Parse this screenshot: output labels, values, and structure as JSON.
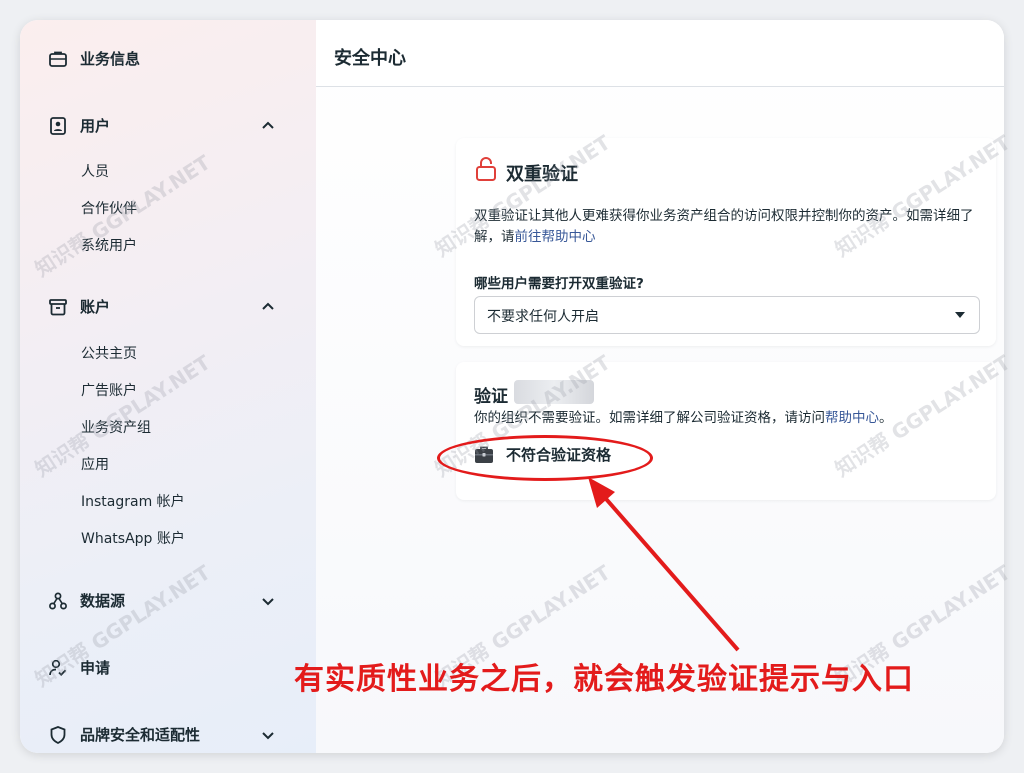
{
  "sidebar": {
    "sections": [
      {
        "label": "业务信息",
        "icon": "briefcase-icon",
        "expanded": null
      },
      {
        "label": "用户",
        "icon": "user-badge-icon",
        "expanded": true,
        "items": [
          "人员",
          "合作伙伴",
          "系统用户"
        ]
      },
      {
        "label": "账户",
        "icon": "archive-icon",
        "expanded": true,
        "items": [
          "公共主页",
          "广告账户",
          "业务资产组",
          "应用",
          "Instagram 帐户",
          "WhatsApp 账户"
        ]
      },
      {
        "label": "数据源",
        "icon": "data-source-icon",
        "expanded": false
      },
      {
        "label": "申请",
        "icon": "user-check-icon",
        "expanded": null
      },
      {
        "label": "品牌安全和适配性",
        "icon": "shield-icon",
        "expanded": false
      }
    ]
  },
  "header": {
    "title": "安全中心"
  },
  "two_factor": {
    "title": "双重验证",
    "description": "双重验证让其他人更难获得你业务资产组合的访问权限并控制你的资产。如需详细了解，请",
    "help_link": "前往帮助中心",
    "question": "哪些用户需要打开双重验证?",
    "select_value": "不要求任何人开启"
  },
  "verification": {
    "title": "验证",
    "description": "你的组织不需要验证。如需详细了解公司验证资格，请访问",
    "help_link": "帮助中心",
    "description_end": "。",
    "status": "不符合验证资格"
  },
  "annotation": {
    "text": "有实质性业务之后，就会触发验证提示与入口",
    "color": "#e31b1b"
  },
  "watermarks": [
    "知识帮",
    "GGPLAY.NET"
  ],
  "colors": {
    "link": "#385898",
    "lock": "#e0403a",
    "text": "#1c2b33"
  }
}
